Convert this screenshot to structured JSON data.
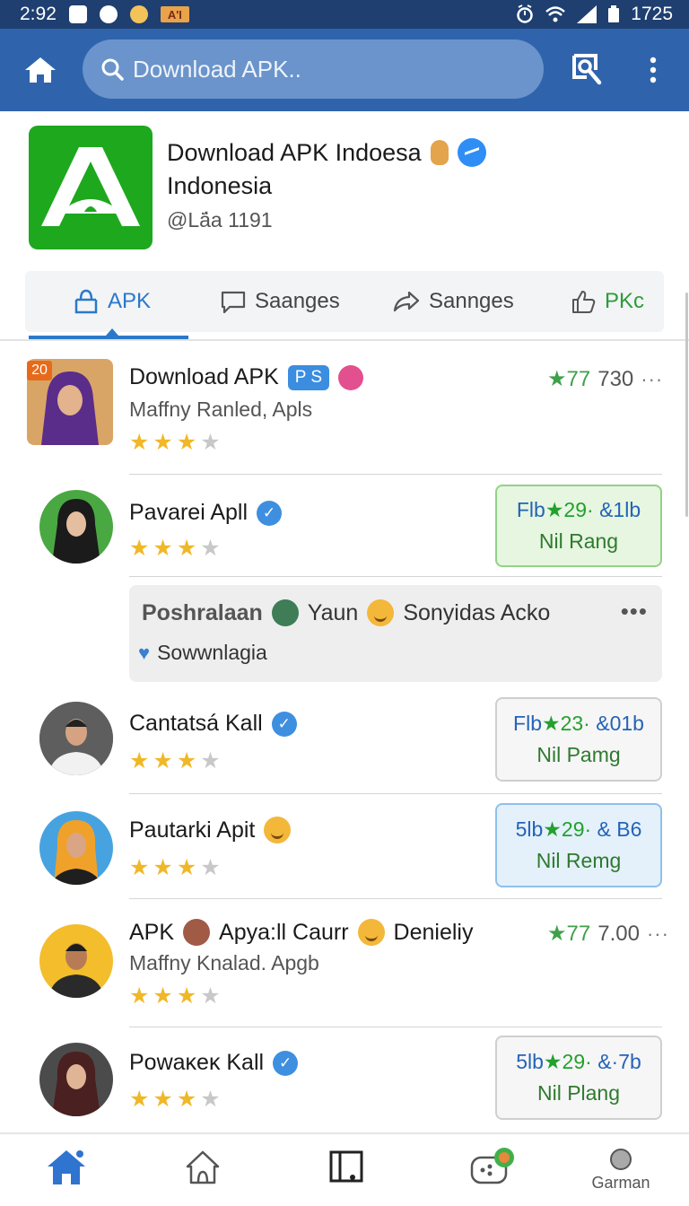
{
  "status_bar": {
    "time": "2:92",
    "carrier_badge": "A'I",
    "battery": "1725"
  },
  "app_bar": {
    "search_placeholder": "Download APK.."
  },
  "profile": {
    "title": "Download APK Indoesa",
    "subtitle": "Indonesia",
    "handle": "@Lá̈a 1191"
  },
  "tabs": [
    {
      "label": "APK",
      "icon": "store-icon",
      "active": true
    },
    {
      "label": "Saanges",
      "icon": "chat-icon",
      "active": false
    },
    {
      "label": "Sannges",
      "icon": "share-icon",
      "active": false
    },
    {
      "label": "PKc",
      "icon": "thumbs-up-icon",
      "active": false
    }
  ],
  "items": [
    {
      "badge": "20",
      "name": "Download APK",
      "pill": "P S",
      "sub": "Maffny Ranled, Apls",
      "stars": 3,
      "rating": "★77",
      "count": "730",
      "more": "···"
    },
    {
      "name": "Pavarei Apll",
      "stars": 3,
      "card": {
        "l1_a": "Flb",
        "l1_b": "★29·",
        "l1_c": "&1lb",
        "l2": "Nil Rang"
      }
    },
    {
      "post": {
        "author": "Poshralaan",
        "mid": "Yaun",
        "text": "Sonyidas Acko",
        "more": "•••",
        "reaction": "Sowwnlagia"
      }
    },
    {
      "name": "Cantatsá Kall",
      "stars": 3.5,
      "card": {
        "l1_a": "Flb",
        "l1_b": "★23·",
        "l1_c": "&01b",
        "l2": "Nil Pamg"
      }
    },
    {
      "name": "Pautarki Apit",
      "stars": 3.5,
      "card": {
        "l1_a": "5lb",
        "l1_b": "★29·",
        "l1_c": "& B6",
        "l2": "Nil Remg"
      }
    },
    {
      "name_a": "APK",
      "name_b": "Apya:ll Caurr",
      "name_c": "Denieliy",
      "sub": "Maffny Knalad. Apgb",
      "stars": 3,
      "rating": "★77",
      "count": "7.00",
      "more": "···"
    },
    {
      "name": "Powaκeκ Kall",
      "stars": 3,
      "card": {
        "l1_a": "5lb",
        "l1_b": "★29·",
        "l1_c": "&·7b",
        "l2": "Nil Plang"
      }
    }
  ],
  "bottom_nav": {
    "last_label": "Garman"
  },
  "colors": {
    "app_bar": "#2f64ad",
    "accent": "#2a79c9",
    "logo_green": "#1ea81e",
    "star": "#f0b828"
  }
}
